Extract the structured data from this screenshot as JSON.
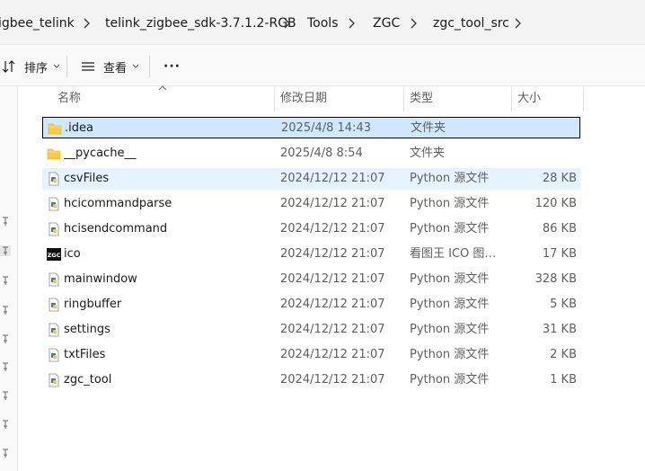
{
  "breadcrumb": {
    "items": [
      "igbee_telink",
      "telink_zigbee_sdk-3.7.1.2-RGB",
      "Tools",
      "ZGC",
      "zgc_tool_src"
    ]
  },
  "toolbar": {
    "sort_label": "排序",
    "view_label": "查看",
    "more_label": "···"
  },
  "columns": {
    "name": "名称",
    "date": "修改日期",
    "type": "类型",
    "size": "大小"
  },
  "files": [
    {
      "name": ".idea",
      "date": "2025/4/8 14:43",
      "type": "文件夹",
      "size": "",
      "icon": "folder-icon",
      "state": "selected"
    },
    {
      "name": "__pycache__",
      "date": "2025/4/8 8:54",
      "type": "文件夹",
      "size": "",
      "icon": "folder-icon",
      "state": ""
    },
    {
      "name": "csvFiles",
      "date": "2024/12/12 21:07",
      "type": "Python 源文件",
      "size": "28 KB",
      "icon": "python-file-icon",
      "state": "hover"
    },
    {
      "name": "hcicommandparse",
      "date": "2024/12/12 21:07",
      "type": "Python 源文件",
      "size": "120 KB",
      "icon": "python-file-icon",
      "state": ""
    },
    {
      "name": "hcisendcommand",
      "date": "2024/12/12 21:07",
      "type": "Python 源文件",
      "size": "86 KB",
      "icon": "python-file-icon",
      "state": ""
    },
    {
      "name": "ico",
      "date": "2024/12/12 21:07",
      "type": "看图王 ICO 图片...",
      "size": "17 KB",
      "icon": "ico-file-icon",
      "state": ""
    },
    {
      "name": "mainwindow",
      "date": "2024/12/12 21:07",
      "type": "Python 源文件",
      "size": "328 KB",
      "icon": "python-file-icon",
      "state": ""
    },
    {
      "name": "ringbuffer",
      "date": "2024/12/12 21:07",
      "type": "Python 源文件",
      "size": "5 KB",
      "icon": "python-file-icon",
      "state": ""
    },
    {
      "name": "settings",
      "date": "2024/12/12 21:07",
      "type": "Python 源文件",
      "size": "31 KB",
      "icon": "python-file-icon",
      "state": ""
    },
    {
      "name": "txtFiles",
      "date": "2024/12/12 21:07",
      "type": "Python 源文件",
      "size": "2 KB",
      "icon": "python-file-icon",
      "state": ""
    },
    {
      "name": "zgc_tool",
      "date": "2024/12/12 21:07",
      "type": "Python 源文件",
      "size": "1 KB",
      "icon": "python-file-icon",
      "state": ""
    }
  ],
  "ico_icon_text": "ZGC",
  "colors": {
    "selection": "#cde8ff",
    "hover": "#e5f3ff",
    "folder": "#f8c94a"
  }
}
